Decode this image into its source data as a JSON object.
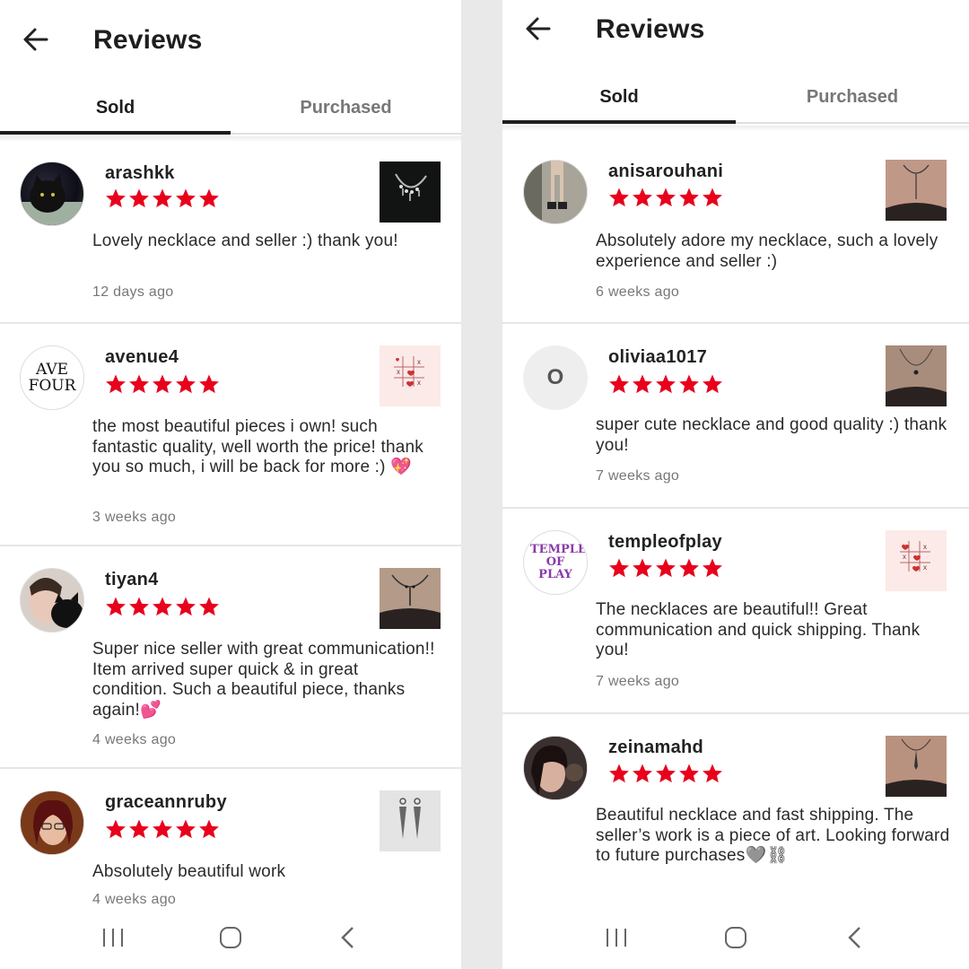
{
  "left": {
    "title": "Reviews",
    "tabs": {
      "sold": "Sold",
      "purchased": "Purchased"
    },
    "reviews": [
      {
        "username": "arashkk",
        "rating": 5,
        "text": "Lovely necklace and seller :) thank you!",
        "date": "12 days ago"
      },
      {
        "username": "avenue4",
        "rating": 5,
        "text": "the most beautiful pieces i own! such fantastic quality, well worth the price! thank you so much, i will be back for more :) 💖",
        "date": "3 weeks ago",
        "avatar_text": "AVE FOUR"
      },
      {
        "username": "tiyan4",
        "rating": 5,
        "text": "Super nice seller with great communication!! Item arrived super quick & in great condition. Such a beautiful piece, thanks again!💕",
        "date": "4 weeks ago"
      },
      {
        "username": "graceannruby",
        "rating": 5,
        "text": "Absolutely beautiful work",
        "date": "4 weeks ago"
      }
    ]
  },
  "right": {
    "title": "Reviews",
    "tabs": {
      "sold": "Sold",
      "purchased": "Purchased"
    },
    "reviews": [
      {
        "username": "anisarouhani",
        "rating": 5,
        "text": "Absolutely adore my necklace, such a lovely experience and seller :)",
        "date": "6 weeks ago"
      },
      {
        "username": "oliviaa1017",
        "rating": 5,
        "text": "super cute necklace and good quality :) thank you!",
        "date": "7 weeks ago",
        "avatar_text": "O"
      },
      {
        "username": "templeofplay",
        "rating": 5,
        "text": "The necklaces are beautiful!! Great communication and quick shipping. Thank you!",
        "date": "7 weeks ago",
        "avatar_text": "TEMPLE OF PLAY"
      },
      {
        "username": "zeinamahd",
        "rating": 5,
        "text": "Beautiful necklace and fast shipping. The seller’s work is a piece of art. Looking forward to future purchases🩶⛓",
        "date": ""
      }
    ]
  },
  "colors": {
    "star": "#e8001c",
    "accent": "#1e1e1e",
    "muted": "#777777"
  },
  "icons": {
    "back": "arrow-left-icon",
    "nav_recent": "recent-apps-icon",
    "nav_home": "home-icon",
    "nav_back": "back-chevron-icon"
  }
}
